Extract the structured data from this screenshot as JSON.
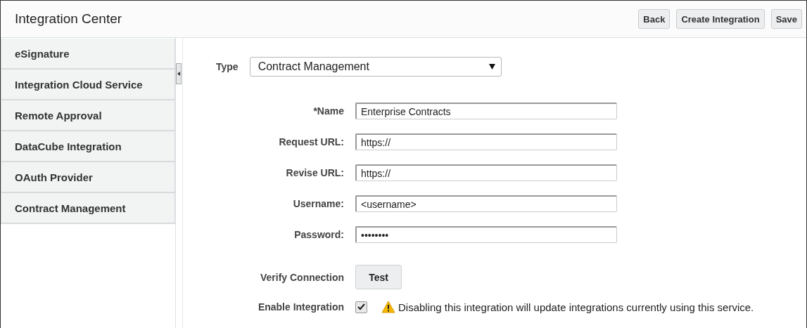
{
  "header": {
    "title": "Integration Center",
    "buttons": [
      "Back",
      "Create Integration",
      "Save"
    ]
  },
  "sidebar": {
    "items": [
      {
        "label": "eSignature"
      },
      {
        "label": "Integration Cloud Service"
      },
      {
        "label": "Remote Approval"
      },
      {
        "label": "DataCube Integration"
      },
      {
        "label": "OAuth Provider"
      },
      {
        "label": "Contract Management"
      }
    ]
  },
  "type": {
    "label": "Type",
    "value": "Contract Management"
  },
  "fields": [
    {
      "label": "*Name",
      "value": "Enterprise Contracts"
    },
    {
      "label": "Request URL:",
      "value": "https://"
    },
    {
      "label": "Revise URL:",
      "value": "https://"
    },
    {
      "label": "Username:",
      "value": "<username>"
    },
    {
      "label": "Password:",
      "value": "••••••••"
    }
  ],
  "verify": {
    "label": "Verify Connection",
    "button": "Test"
  },
  "enable": {
    "label": "Enable Integration",
    "checked": true,
    "warning": "Disabling this integration will update integrations currently using this service."
  }
}
